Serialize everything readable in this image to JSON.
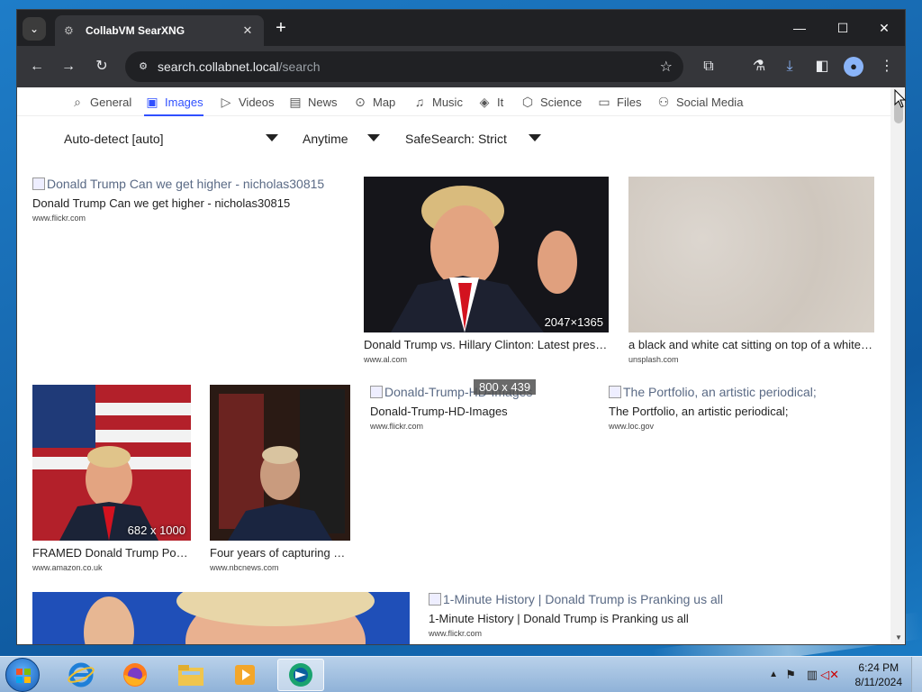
{
  "browser": {
    "tab_title": "CollabVM SearXNG",
    "tab_close": "✕",
    "new_tab": "+",
    "url_host": "search.collabnet.local",
    "url_path": "/search",
    "controls": {
      "minimize": "—",
      "maximize": "☐",
      "close": "✕"
    }
  },
  "categories": [
    {
      "label": "General",
      "icon": "search-icon",
      "glyph": "⌕"
    },
    {
      "label": "Images",
      "icon": "image-icon",
      "glyph": "▣"
    },
    {
      "label": "Videos",
      "icon": "play-icon",
      "glyph": "▷"
    },
    {
      "label": "News",
      "icon": "newspaper-icon",
      "glyph": "▤"
    },
    {
      "label": "Map",
      "icon": "map-pin-icon",
      "glyph": "⊙"
    },
    {
      "label": "Music",
      "icon": "music-note-icon",
      "glyph": "♫"
    },
    {
      "label": "It",
      "icon": "layers-icon",
      "glyph": "◈"
    },
    {
      "label": "Science",
      "icon": "cube-icon",
      "glyph": "⬡"
    },
    {
      "label": "Files",
      "icon": "files-icon",
      "glyph": "▭"
    },
    {
      "label": "Social Media",
      "icon": "people-icon",
      "glyph": "⚇"
    }
  ],
  "filters": {
    "language": "Auto-detect [auto]",
    "time": "Anytime",
    "safesearch": "SafeSearch: Strict"
  },
  "results": [
    {
      "alt": "Donald Trump Can we get higher - nicholas30815",
      "title": "Donald Trump Can we get higher - nicholas30815",
      "url": "www.flickr.com"
    },
    {
      "title": "Donald Trump vs. Hillary Clinton: Latest presi…",
      "url": "www.al.com",
      "dims": "2047×1365"
    },
    {
      "title": "a black and white cat sitting on top of a white…",
      "url": "unsplash.com"
    },
    {
      "title": "FRAMED Donald Trump Po…",
      "url": "www.amazon.co.uk",
      "dims": "682 x 1000"
    },
    {
      "title": "Four years of capturing …",
      "url": "www.nbcnews.com"
    },
    {
      "alt": "Donald-Trump-HD-Images",
      "title": "Donald-Trump-HD-Images",
      "url": "www.flickr.com",
      "hover_dims": "800 x 439"
    },
    {
      "alt": "The Portfolio, an artistic periodical;",
      "title": "The Portfolio, an artistic periodical;",
      "url": "www.loc.gov"
    },
    {
      "alt": "1-Minute History | Donald Trump is Pranking us all",
      "title": "1-Minute History | Donald Trump is Pranking us all",
      "url": "www.flickr.com"
    }
  ],
  "taskbar": {
    "time": "6:24 PM",
    "date": "8/11/2024",
    "apps": [
      "internet-explorer-icon",
      "firefox-icon",
      "file-explorer-icon",
      "media-player-icon",
      "browser-app-icon"
    ]
  }
}
